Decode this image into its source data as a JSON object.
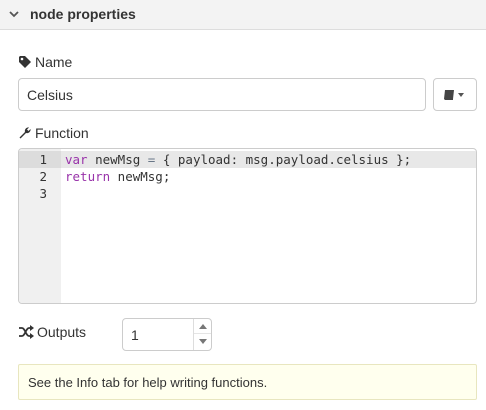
{
  "header": {
    "title": "node properties",
    "icon": "chevron-down-icon"
  },
  "name_field": {
    "label": "Name",
    "icon": "tag-icon",
    "value": "Celsius",
    "library_icon": "book-icon",
    "library_dropdown_icon": "caret-down-icon"
  },
  "function_field": {
    "label": "Function",
    "icon": "wrench-icon",
    "line_numbers": [
      "1",
      "2",
      "3"
    ],
    "code_lines": [
      {
        "kw": "var",
        "rest": " newMsg ",
        "op": "=",
        "tail": " { payload: msg.payload.celsius };"
      },
      {
        "kw": "return",
        "rest": " newMsg;",
        "op": "",
        "tail": ""
      },
      {
        "kw": "",
        "rest": "",
        "op": "",
        "tail": ""
      }
    ]
  },
  "outputs_field": {
    "label": "Outputs",
    "icon": "shuffle-icon",
    "value": "1"
  },
  "help": {
    "text": "See the Info tab for help writing functions."
  },
  "colors": {
    "keyword": "#9933aa",
    "help_bg": "#ffffee",
    "header_bg": "#f3f3f3"
  }
}
